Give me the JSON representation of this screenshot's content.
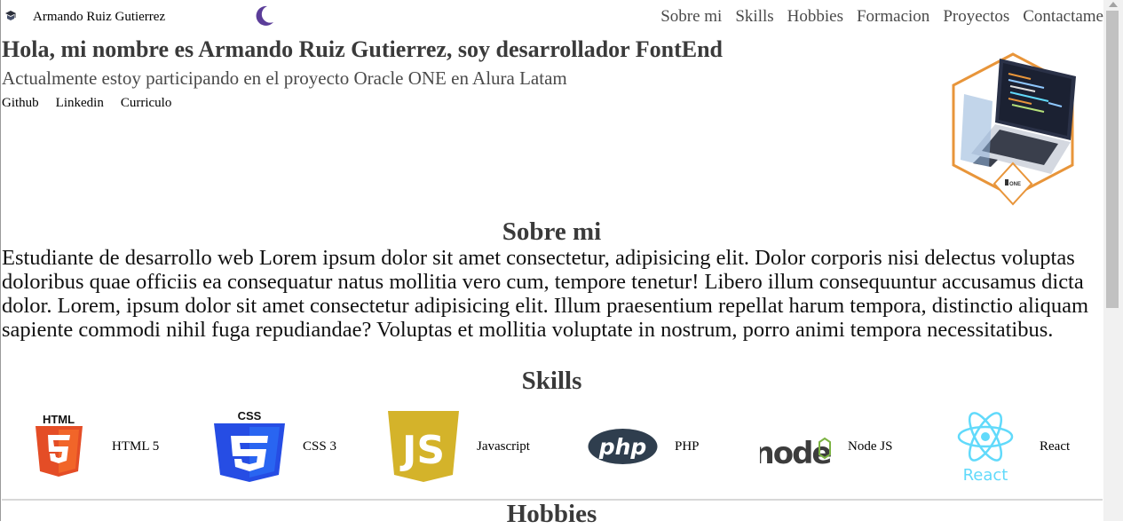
{
  "header": {
    "brand_name": "Armando Ruiz Gutierrez",
    "nav": [
      "Sobre mi",
      "Skills",
      "Hobbies",
      "Formacion",
      "Proyectos",
      "Contactame"
    ]
  },
  "hero": {
    "title": "Hola, mi nombre es Armando Ruiz Gutierrez, soy desarrollador FontEnd",
    "subtitle": "Actualmente estoy participando en el proyecto Oracle ONE en Alura Latam",
    "links": [
      "Github",
      "Linkedin",
      "Curriculo"
    ],
    "badge_text": "ONE"
  },
  "about": {
    "title": "Sobre mi",
    "text": "Estudiante de desarrollo web Lorem ipsum dolor sit amet consectetur, adipisicing elit. Dolor corporis nisi delectus voluptas doloribus quae officiis ea consequatur natus mollitia vero cum, tempore tenetur! Libero illum consequuntur accusamus dicta dolor. Lorem, ipsum dolor sit amet consectetur adipisicing elit. Illum praesentium repellat harum tempora, distinctio aliquam sapiente commodi nihil fuga repudiandae? Voluptas et mollitia voluptate in nostrum, porro animi tempora necessitatibus."
  },
  "skills": {
    "title": "Skills",
    "items": [
      {
        "label": "HTML 5",
        "icon": "html5-icon",
        "logo_text": "HTML"
      },
      {
        "label": "CSS 3",
        "icon": "css3-icon",
        "logo_text": "CSS"
      },
      {
        "label": "Javascript",
        "icon": "javascript-icon",
        "logo_text": "JS"
      },
      {
        "label": "PHP",
        "icon": "php-icon",
        "logo_text": "php"
      },
      {
        "label": "Node JS",
        "icon": "nodejs-icon",
        "logo_text": "node"
      },
      {
        "label": "React",
        "icon": "react-icon",
        "logo_text": "React"
      }
    ]
  },
  "hobbies": {
    "title": "Hobbies"
  },
  "colors": {
    "html": "#e44d26",
    "css": "#264de4",
    "js": "#d4b32a",
    "php": "#2f3e4e",
    "node": "#3c3c3c",
    "react": "#61dafb",
    "moon": "#5b3d99",
    "hexagon": "#e8953a"
  }
}
